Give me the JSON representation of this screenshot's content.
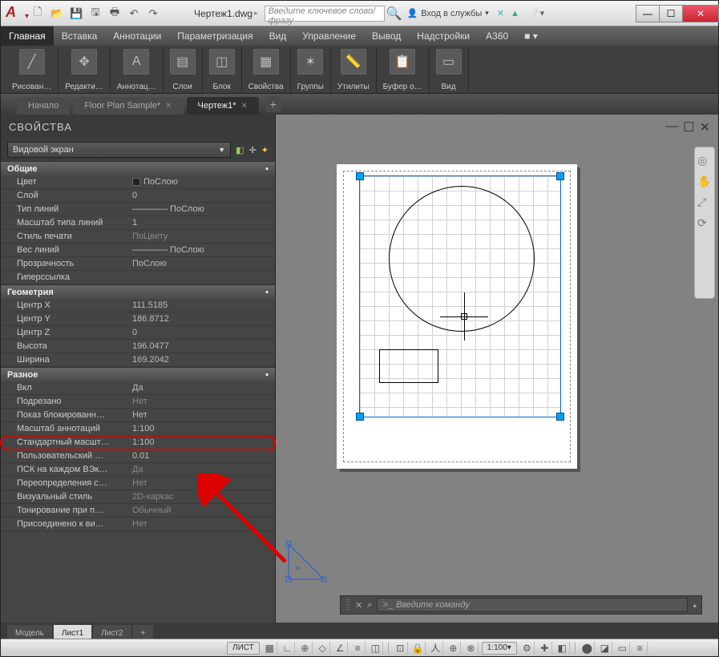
{
  "app": {
    "logo_text": "A",
    "filename": "Чертеж1.dwg"
  },
  "search": {
    "placeholder": "Введите ключевое слово/фразу"
  },
  "login": {
    "label": "Вход в службы"
  },
  "menubar": [
    "Главная",
    "Вставка",
    "Аннотации",
    "Параметризация",
    "Вид",
    "Управление",
    "Вывод",
    "Надстройки",
    "A360"
  ],
  "menubar_active": 0,
  "ribbon": [
    {
      "label": "Рисован…",
      "icon": "╱"
    },
    {
      "label": "Редакти…",
      "icon": "✥"
    },
    {
      "label": "Аннотац…",
      "icon": "A"
    },
    {
      "label": "Слои",
      "icon": "▤"
    },
    {
      "label": "Блок",
      "icon": "◫"
    },
    {
      "label": "Свойства",
      "icon": "▦"
    },
    {
      "label": "Группы",
      "icon": "✶"
    },
    {
      "label": "Утилиты",
      "icon": "📏"
    },
    {
      "label": "Буфер о…",
      "icon": "📋"
    },
    {
      "label": "Вид",
      "icon": "▭"
    }
  ],
  "filetabs": [
    {
      "label": "Начало",
      "active": false,
      "closable": false
    },
    {
      "label": "Floor Plan Sample*",
      "active": false,
      "closable": true
    },
    {
      "label": "Чертеж1*",
      "active": true,
      "closable": true
    }
  ],
  "properties": {
    "title": "СВОЙСТВА",
    "selection": "Видовой экран",
    "sections": [
      {
        "name": "Общие",
        "rows": [
          {
            "label": "Цвет",
            "value": "ПоСлою",
            "swatch": true
          },
          {
            "label": "Слой",
            "value": "0"
          },
          {
            "label": "Тип линий",
            "value": "———— ПоСлою"
          },
          {
            "label": "Масштаб типа линий",
            "value": "1"
          },
          {
            "label": "Стиль печати",
            "value": "ПоЦвету",
            "dim": true
          },
          {
            "label": "Вес линий",
            "value": "———— ПоСлою"
          },
          {
            "label": "Прозрачность",
            "value": "ПоСлою"
          },
          {
            "label": "Гиперссылка",
            "value": ""
          }
        ]
      },
      {
        "name": "Геометрия",
        "rows": [
          {
            "label": "Центр X",
            "value": "111.5185"
          },
          {
            "label": "Центр Y",
            "value": "186.8712"
          },
          {
            "label": "Центр Z",
            "value": "0"
          },
          {
            "label": "Высота",
            "value": "196.0477"
          },
          {
            "label": "Ширина",
            "value": "169.2042"
          }
        ]
      },
      {
        "name": "Разное",
        "rows": [
          {
            "label": "Вкл",
            "value": "Да"
          },
          {
            "label": "Подрезано",
            "value": "Нет",
            "dim": true
          },
          {
            "label": "Показ блокированн…",
            "value": "Нет"
          },
          {
            "label": "Масштаб аннотаций",
            "value": "1:100"
          },
          {
            "label": "Стандартный масшт…",
            "value": "1:100",
            "highlight": true
          },
          {
            "label": "Пользовательский …",
            "value": "0.01"
          },
          {
            "label": "ПСК на каждом ВЭк…",
            "value": "Да",
            "dim": true
          },
          {
            "label": "Переопределения с…",
            "value": "Нет",
            "dim": true
          },
          {
            "label": "Визуальный стиль",
            "value": "2D-каркас",
            "dim": true
          },
          {
            "label": "Тонирование при п…",
            "value": "Обычный",
            "dim": true
          },
          {
            "label": "Присоединено к ви…",
            "value": "Нет",
            "dim": true
          }
        ]
      }
    ]
  },
  "command": {
    "prompt_icon": ">_",
    "placeholder": "Введите команду"
  },
  "sheets": [
    {
      "label": "Модель",
      "active": false
    },
    {
      "label": "Лист1",
      "active": true
    },
    {
      "label": "Лист2",
      "active": false
    }
  ],
  "status": {
    "space": "ЛИСТ",
    "scale": "1:100"
  }
}
